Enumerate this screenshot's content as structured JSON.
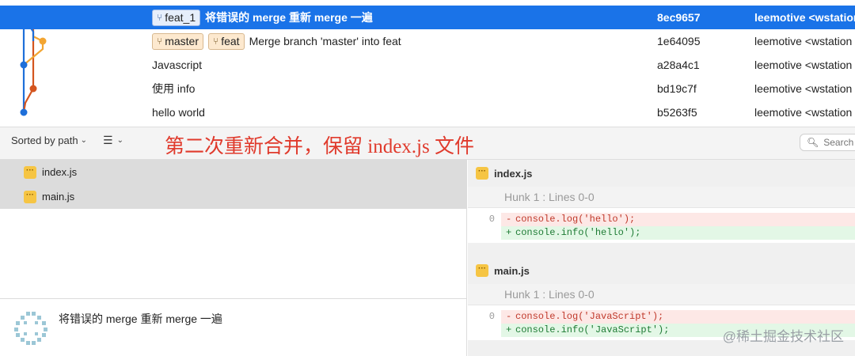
{
  "commits": [
    {
      "refs": [
        "feat_1"
      ],
      "subject": "将错误的 merge 重新 merge 一遍",
      "hash": "8ec9657",
      "author": "leemotive <wstation",
      "selected": true
    },
    {
      "refs": [
        "master",
        "feat"
      ],
      "subject": "Merge branch 'master' into feat",
      "hash": "1e64095",
      "author": "leemotive <wstation"
    },
    {
      "refs": [],
      "subject": "Javascript",
      "hash": "a28a4c1",
      "author": "leemotive <wstation"
    },
    {
      "refs": [],
      "subject": "使用 info",
      "hash": "bd19c7f",
      "author": "leemotive <wstation"
    },
    {
      "refs": [],
      "subject": "hello world",
      "hash": "b5263f5",
      "author": "leemotive <wstation"
    }
  ],
  "graph": {
    "colors": {
      "blue": "#1e6fd9",
      "orange_light": "#f3a531",
      "orange_dark": "#d4551f"
    }
  },
  "toolbar": {
    "sort_label": "Sorted by path",
    "view_icon": "list-icon",
    "annotation": "第二次重新合并，保留 index.js 文件",
    "search_placeholder": "Search"
  },
  "files": [
    {
      "name": "index.js",
      "status_icon": "modified-file-icon"
    },
    {
      "name": "main.js",
      "status_icon": "modified-file-icon"
    }
  ],
  "detail": {
    "subject": "将错误的 merge 重新 merge 一遍"
  },
  "diffs": [
    {
      "file": "index.js",
      "hunk": "Hunk 1 : Lines 0-0",
      "line_number": "0",
      "removed": "console.log('hello');",
      "added": "console.info('hello');"
    },
    {
      "file": "main.js",
      "hunk": "Hunk 1 : Lines 0-0",
      "line_number": "0",
      "removed": "console.log('JavaScript');",
      "added": "console.info('JavaScript');"
    }
  ],
  "watermark": "@稀土掘金技术社区",
  "colors": {
    "selection": "#1a73e8",
    "annotation": "#e03a2c",
    "ref_tag": "#fde9cf"
  }
}
